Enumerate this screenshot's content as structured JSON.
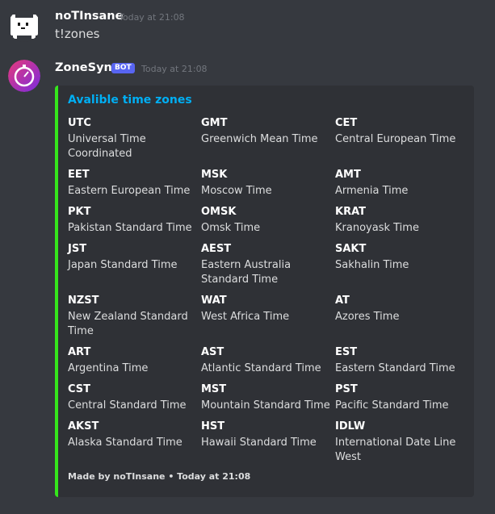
{
  "messages": [
    {
      "username": "noTInsane",
      "timestamp": "Today at 21:08",
      "text": "t!zones"
    },
    {
      "username": "ZoneSync",
      "bot_tag": "BOT",
      "timestamp": "Today at 21:08"
    }
  ],
  "embed": {
    "title": "Avalible time zones",
    "accent_color": "#35e61c",
    "fields": [
      {
        "name": "UTC",
        "value": "Universal Time Coordinated"
      },
      {
        "name": "GMT",
        "value": "Greenwich Mean Time"
      },
      {
        "name": "CET",
        "value": "Central European Time"
      },
      {
        "name": "EET",
        "value": "Eastern European Time"
      },
      {
        "name": "MSK",
        "value": "Moscow Time"
      },
      {
        "name": "AMT",
        "value": "Armenia Time"
      },
      {
        "name": "PKT",
        "value": "Pakistan Standard Time"
      },
      {
        "name": "OMSK",
        "value": "Omsk Time"
      },
      {
        "name": "KRAT",
        "value": "Kranoyask Time"
      },
      {
        "name": "JST",
        "value": "Japan Standard Time"
      },
      {
        "name": "AEST",
        "value": "Eastern Australia Standard Time"
      },
      {
        "name": "SAKT",
        "value": "Sakhalin Time"
      },
      {
        "name": "NZST",
        "value": "New Zealand Standard Time"
      },
      {
        "name": "WAT",
        "value": "West Africa Time"
      },
      {
        "name": "AT",
        "value": "Azores Time"
      },
      {
        "name": "ART",
        "value": "Argentina Time"
      },
      {
        "name": "AST",
        "value": "Atlantic Standard Time"
      },
      {
        "name": "EST",
        "value": "Eastern Standard Time"
      },
      {
        "name": "CST",
        "value": "Central Standard Time"
      },
      {
        "name": "MST",
        "value": "Mountain Standard Time"
      },
      {
        "name": "PST",
        "value": "Pacific Standard Time"
      },
      {
        "name": "AKST",
        "value": "Alaska Standard Time"
      },
      {
        "name": "HST",
        "value": "Hawaii Standard Time"
      },
      {
        "name": "IDLW",
        "value": "International Date Line West"
      }
    ],
    "footer": "Made by noTInsane • Today at 21:08"
  },
  "colors": {
    "background": "#36393f",
    "embed_background": "#2f3136",
    "link": "#00aff4",
    "bot_tag": "#5865f2"
  },
  "icons": [
    "dog-avatar-icon",
    "stopwatch-avatar-icon"
  ]
}
